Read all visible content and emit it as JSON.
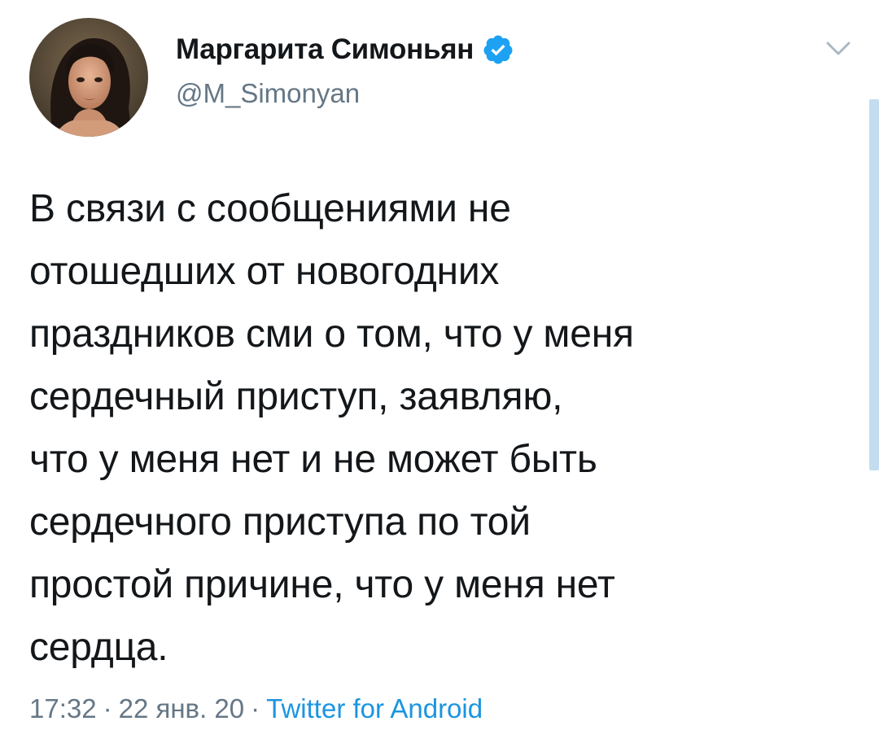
{
  "author": {
    "display_name": "Маргарита Симоньян",
    "handle": "@M_Simonyan",
    "verified": true,
    "verified_color": "#1da1f2"
  },
  "tweet": {
    "lines": [
      "В связи с сообщениями не",
      "отошедших от новогодних",
      "праздников сми о том, что у меня",
      "сердечный приступ, заявляю,",
      "что у меня нет и не может быть",
      "сердечного приступа по той",
      "простой причине, что у меня нет",
      "сердца."
    ]
  },
  "meta": {
    "time": "17:32",
    "date": "22 янв. 20",
    "separator": "·",
    "source": "Twitter for Android"
  },
  "icons": {
    "verified": "verified-badge-icon",
    "menu": "chevron-down-icon"
  },
  "colors": {
    "text": "#14171a",
    "secondary": "#657786",
    "link": "#1b95e0",
    "scrollbar": "#c3dcef"
  }
}
